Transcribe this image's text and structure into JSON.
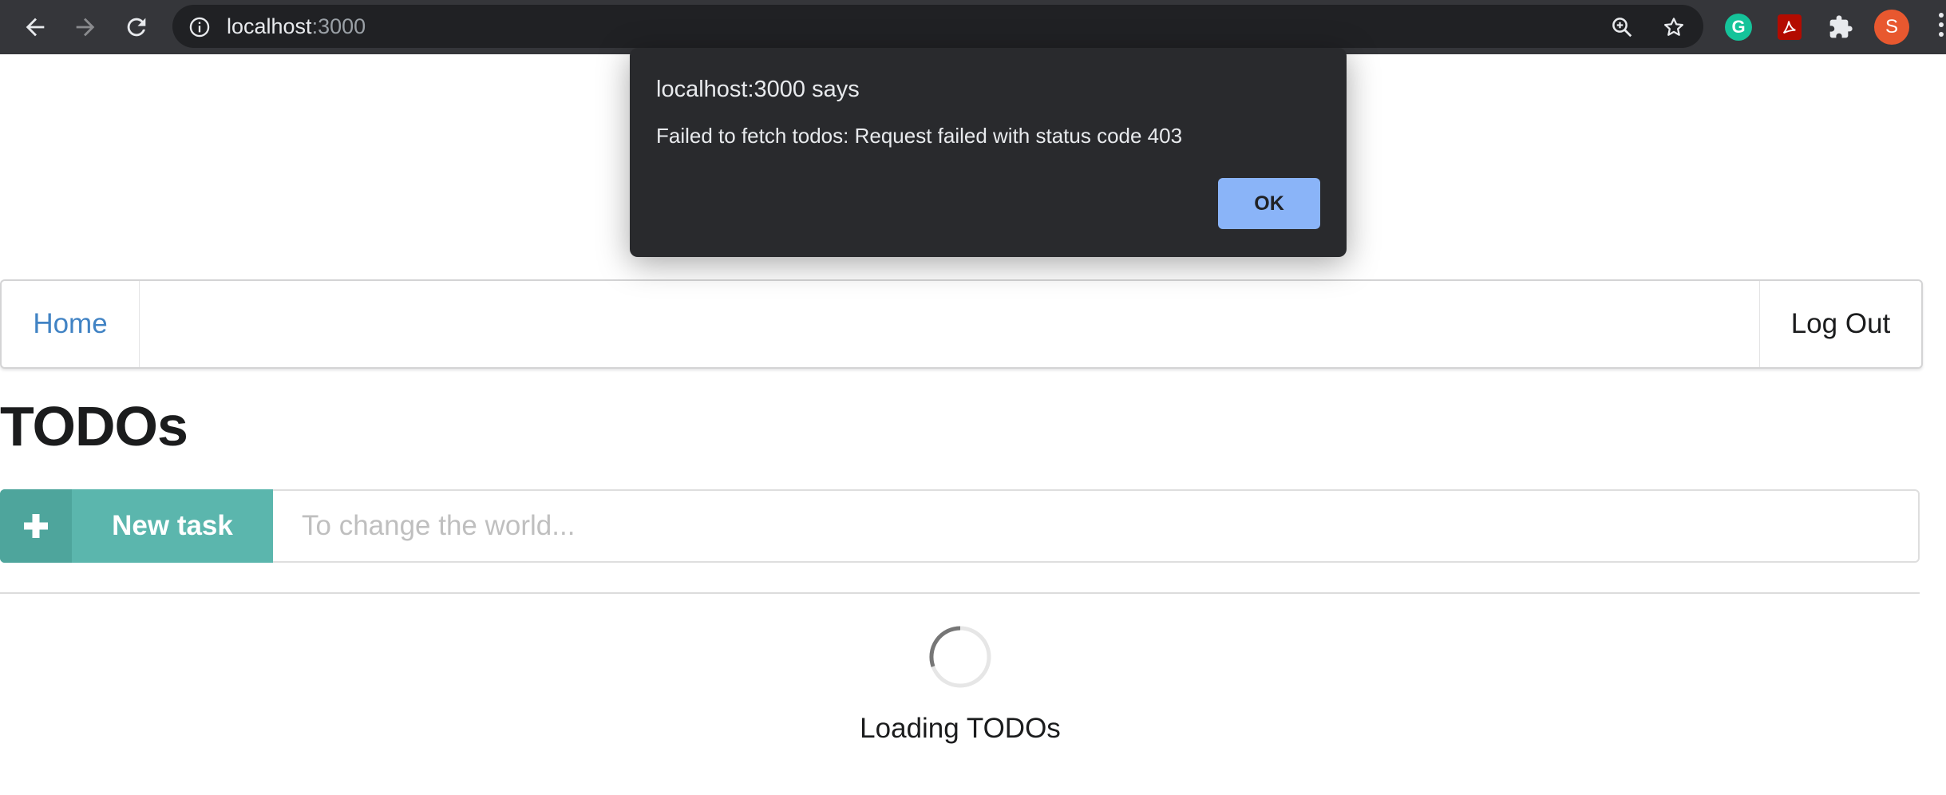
{
  "browser": {
    "url_host": "localhost",
    "url_port": ":3000",
    "profile_initial": "S",
    "grammarly_letter": "G",
    "icons": [
      "back-icon",
      "forward-icon",
      "reload-icon",
      "info-icon",
      "zoom-icon",
      "star-icon",
      "grammarly-icon",
      "acrobat-icon",
      "extensions-icon",
      "profile-avatar",
      "menu-icon"
    ]
  },
  "dialog": {
    "title": "localhost:3000 says",
    "message": "Failed to fetch todos: Request failed with status code 403",
    "ok_label": "OK"
  },
  "navbar": {
    "home_label": "Home",
    "logout_label": "Log Out"
  },
  "main": {
    "title": "TODOs",
    "new_task_label": "New task",
    "new_task_placeholder": "To change the world...",
    "loading_text": "Loading TODOs"
  },
  "colors": {
    "chrome_bg": "#35363a",
    "omnibox_bg": "#202124",
    "link": "#4183c4",
    "teal_button": "#5bb6ad",
    "dialog_bg": "#292a2d",
    "dialog_button": "#8ab4f8"
  }
}
